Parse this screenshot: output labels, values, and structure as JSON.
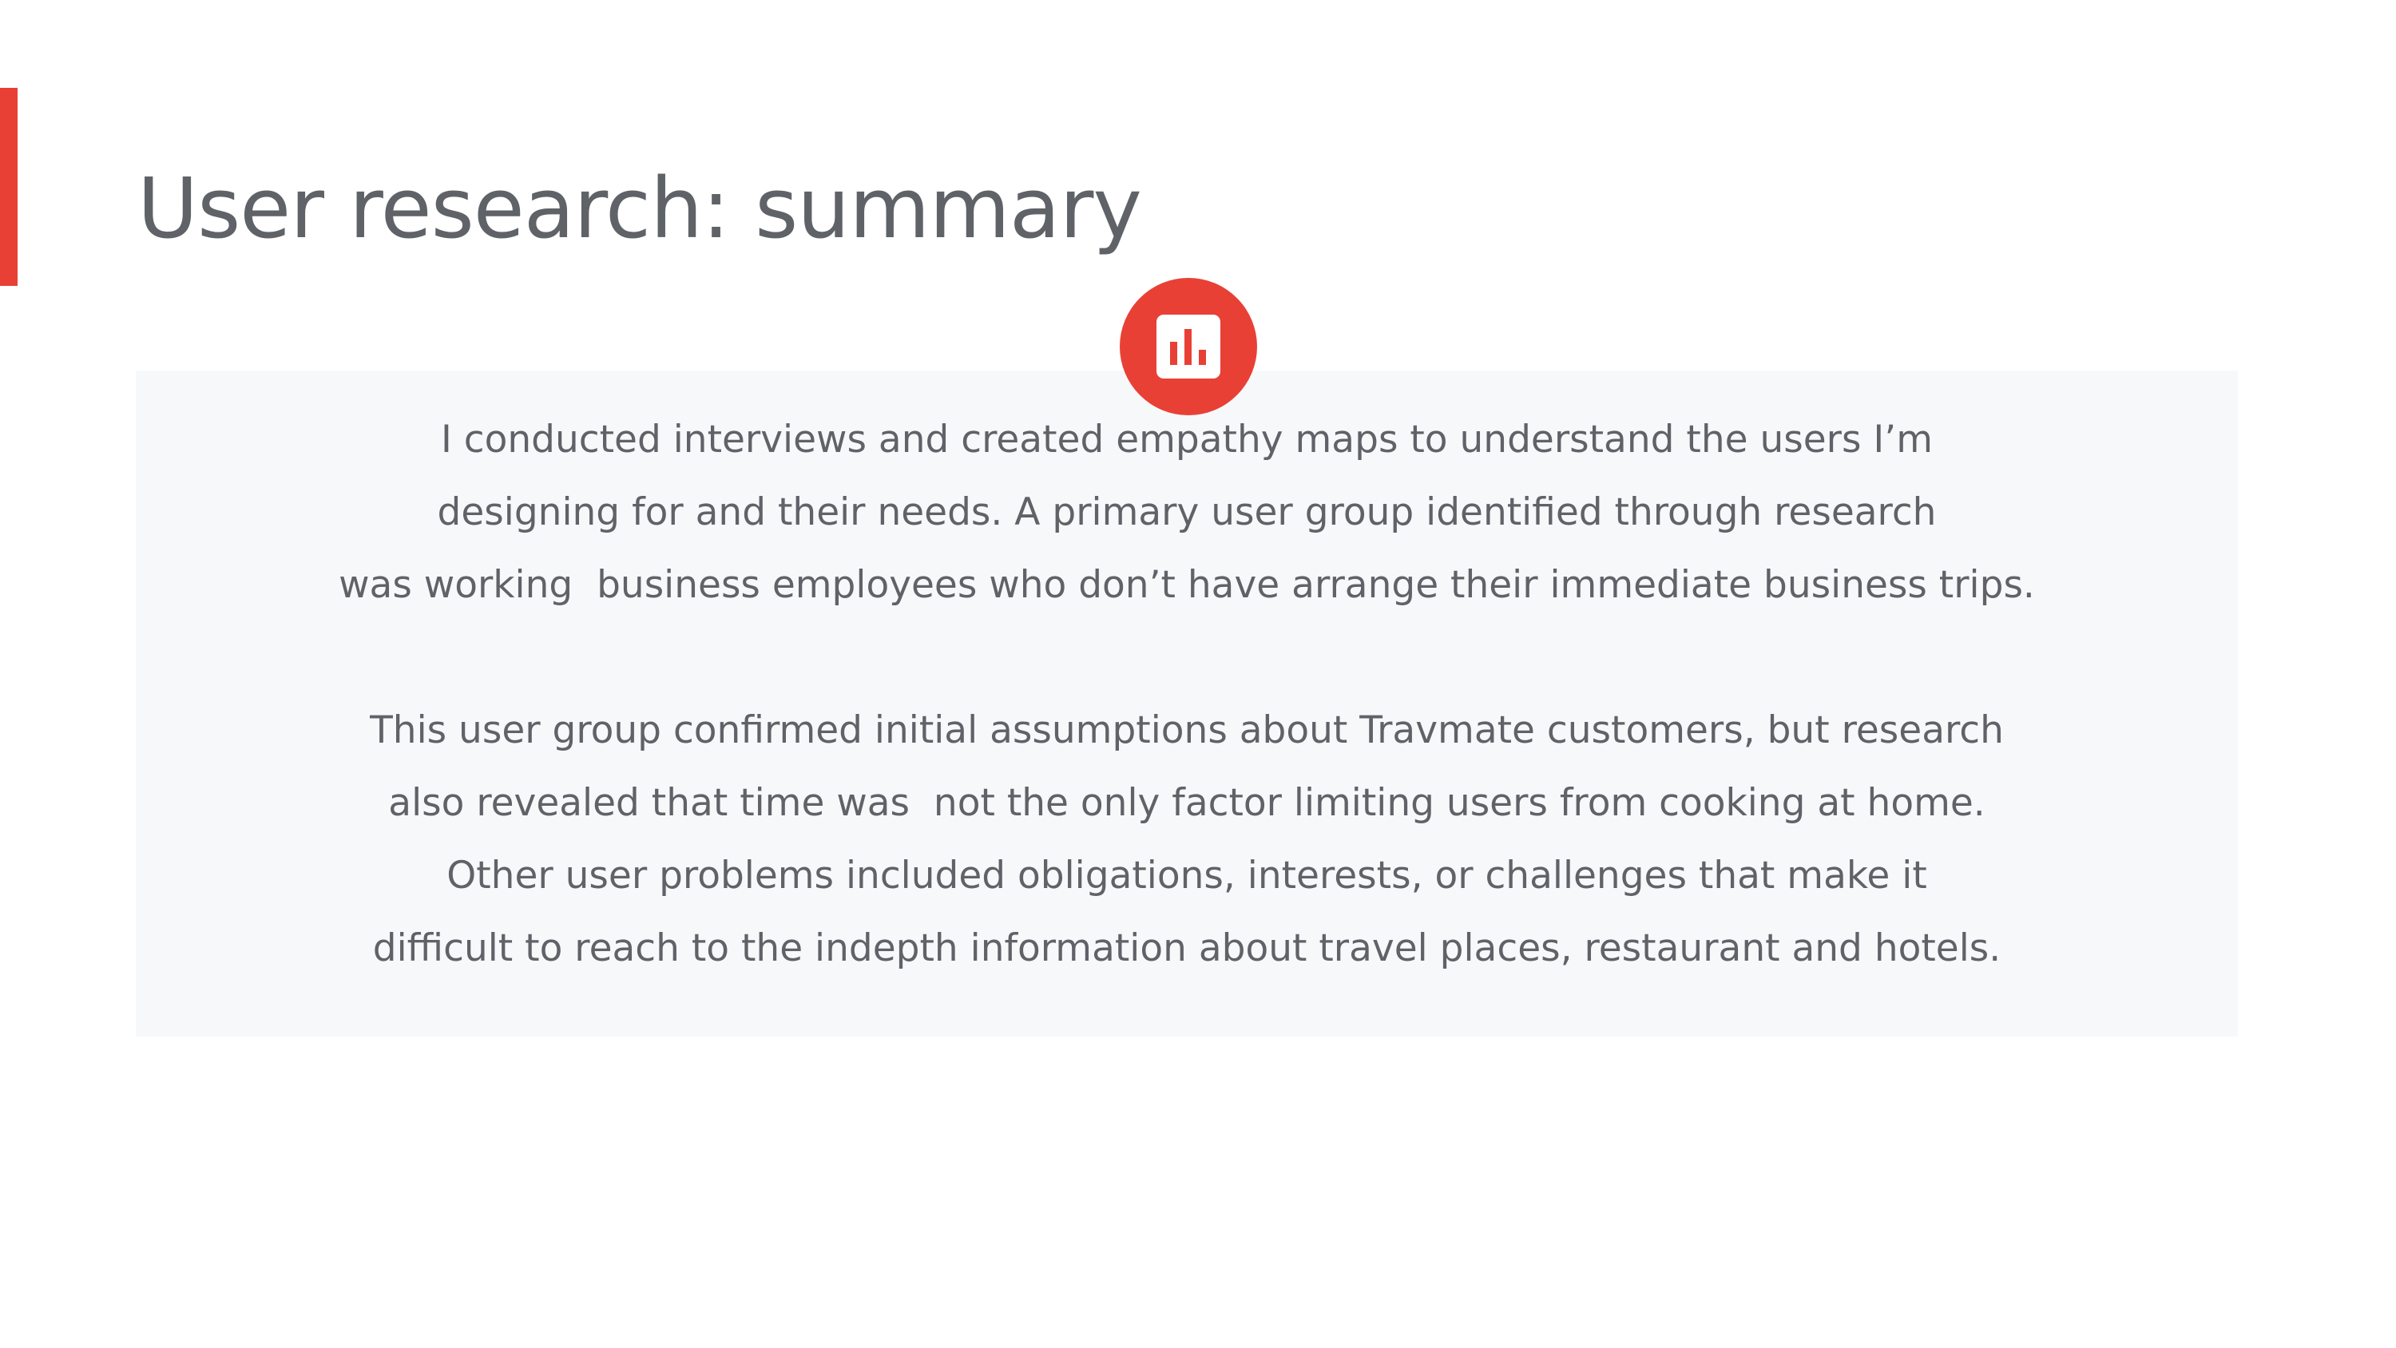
{
  "slide": {
    "title": "User research: summary",
    "icon": "bar-chart-icon",
    "accent_color": "#e94035",
    "paragraphs": [
      {
        "lines": [
          "I conducted interviews and created empathy maps to understand the users I’m",
          "designing for and their needs. A primary user group identified through research",
          "was working  business employees who don’t have arrange their immediate business trips."
        ]
      },
      {
        "lines": [
          "This user group confirmed initial assumptions about Travmate customers, but research",
          "also revealed that time was  not the only factor limiting users from cooking at home.",
          "Other user problems included obligations, interests, or challenges that make it",
          "difficult to reach to the indepth information about travel places, restaurant and hotels."
        ]
      }
    ]
  }
}
